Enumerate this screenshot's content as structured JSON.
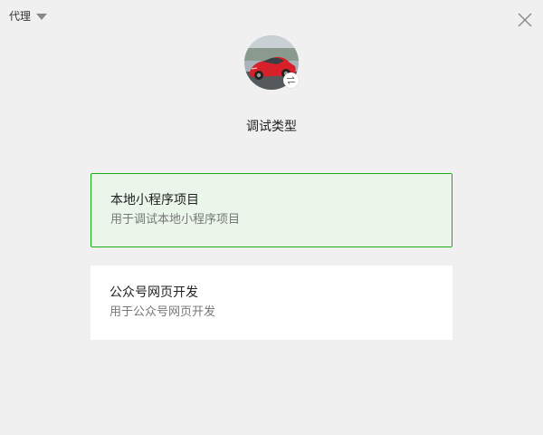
{
  "header": {
    "proxy_label": "代理",
    "proxy_icon": "caret-down-icon",
    "close_icon": "close-icon"
  },
  "profile": {
    "avatar": "red-sports-car-photo",
    "switch_icon": "swap-arrows-icon"
  },
  "section_title": "调试类型",
  "options": [
    {
      "title": "本地小程序项目",
      "description": "用于调试本地小程序项目",
      "selected": true
    },
    {
      "title": "公众号网页开发",
      "description": "用于公众号网页开发",
      "selected": false
    }
  ],
  "colors": {
    "background": "#f0f0f0",
    "selected_border": "#1aad19",
    "selected_background": "#eaf6ea",
    "card_background": "#ffffff"
  }
}
